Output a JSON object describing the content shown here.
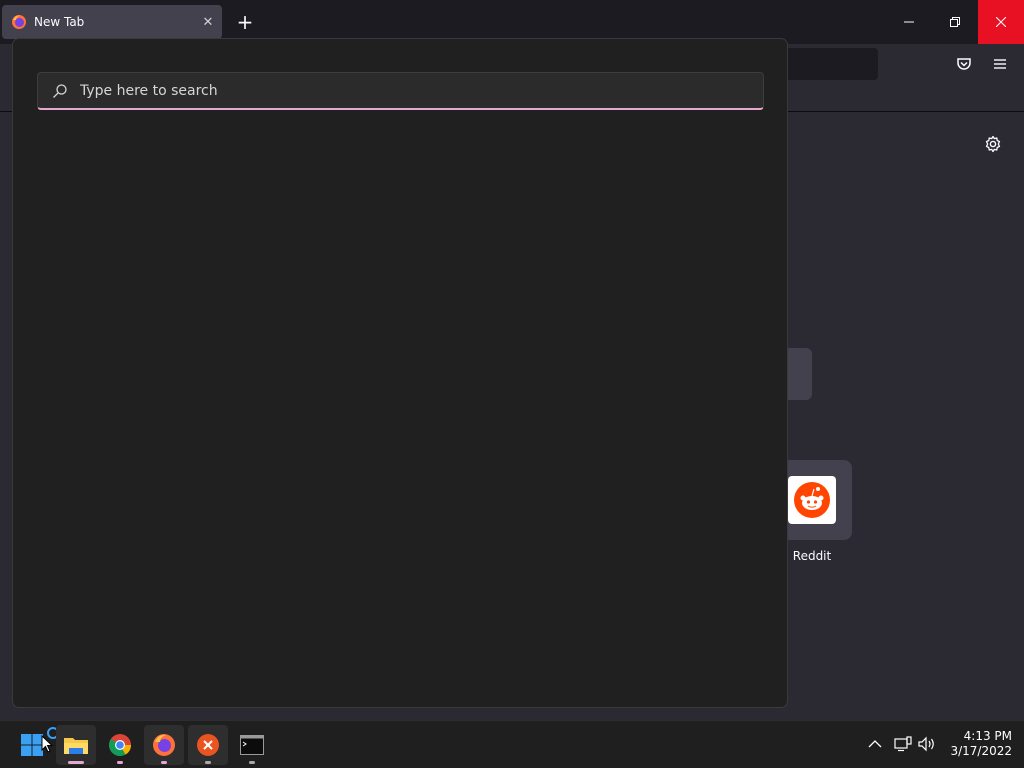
{
  "browser": {
    "tab_title": "New Tab",
    "tab_close_glyph": "✕",
    "newtab_glyph": "+",
    "window_controls": {
      "minimize_glyph": "—",
      "restore_glyph": "❐",
      "close_glyph": "✕"
    }
  },
  "newtab_page": {
    "topsites": [
      {
        "label": "Reddit",
        "icon": "reddit-icon"
      }
    ]
  },
  "search_flyout": {
    "placeholder": "Type here to search"
  },
  "taskbar": {
    "apps": [
      {
        "name": "start",
        "icon": "windows-logo-icon"
      },
      {
        "name": "file-explorer",
        "icon": "folder-icon"
      },
      {
        "name": "chrome",
        "icon": "chrome-icon"
      },
      {
        "name": "firefox",
        "icon": "firefox-icon"
      },
      {
        "name": "app-x",
        "icon": "x-circle-icon"
      },
      {
        "name": "terminal",
        "icon": "terminal-icon"
      }
    ],
    "clock": {
      "time": "4:13 PM",
      "date": "3/17/2022"
    }
  },
  "colors": {
    "accent_pink": "#e6a7d3",
    "close_red": "#e81123",
    "reddit_orange": "#ff4500"
  }
}
